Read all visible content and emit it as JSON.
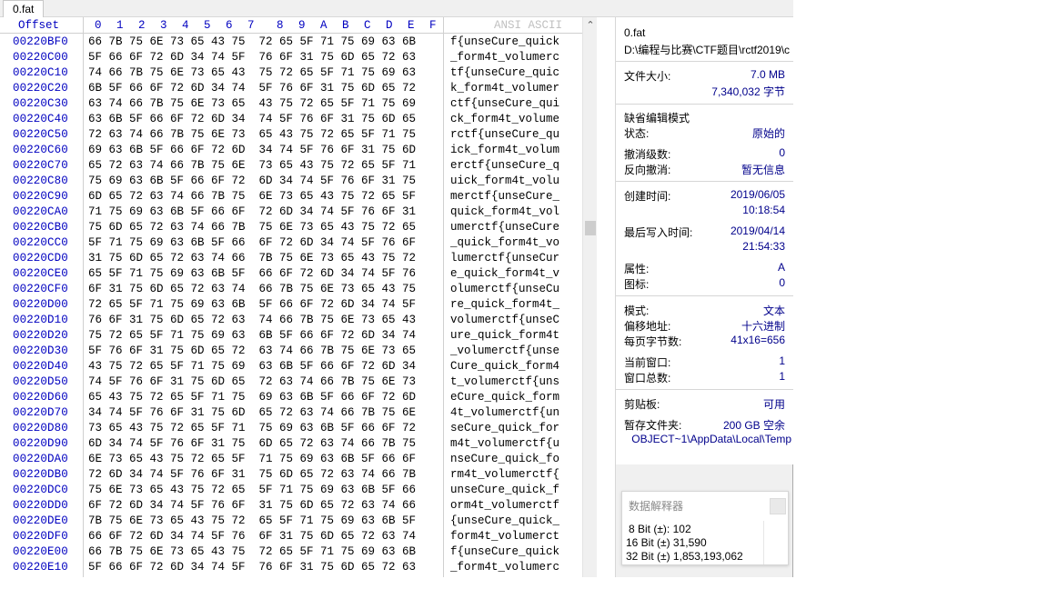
{
  "tab": {
    "label": "0.fat"
  },
  "hex_header": {
    "offset": "Offset",
    "columns": [
      "0",
      "1",
      "2",
      "3",
      "4",
      "5",
      "6",
      "7",
      "8",
      "9",
      "A",
      "B",
      "C",
      "D",
      "E",
      "F"
    ],
    "ascii": "ANSI ASCII"
  },
  "rows": [
    {
      "offset": "00220BF0",
      "hex": "66 7B 75 6E 73 65 43 75  72 65 5F 71 75 69 63 6B",
      "ascii": "f{unseCure_quick"
    },
    {
      "offset": "00220C00",
      "hex": "5F 66 6F 72 6D 34 74 5F  76 6F 31 75 6D 65 72 63",
      "ascii": "_form4t_volumerc"
    },
    {
      "offset": "00220C10",
      "hex": "74 66 7B 75 6E 73 65 43  75 72 65 5F 71 75 69 63",
      "ascii": "tf{unseCure_quic"
    },
    {
      "offset": "00220C20",
      "hex": "6B 5F 66 6F 72 6D 34 74  5F 76 6F 31 75 6D 65 72",
      "ascii": "k_form4t_volumer"
    },
    {
      "offset": "00220C30",
      "hex": "63 74 66 7B 75 6E 73 65  43 75 72 65 5F 71 75 69",
      "ascii": "ctf{unseCure_qui"
    },
    {
      "offset": "00220C40",
      "hex": "63 6B 5F 66 6F 72 6D 34  74 5F 76 6F 31 75 6D 65",
      "ascii": "ck_form4t_volume"
    },
    {
      "offset": "00220C50",
      "hex": "72 63 74 66 7B 75 6E 73  65 43 75 72 65 5F 71 75",
      "ascii": "rctf{unseCure_qu"
    },
    {
      "offset": "00220C60",
      "hex": "69 63 6B 5F 66 6F 72 6D  34 74 5F 76 6F 31 75 6D",
      "ascii": "ick_form4t_volum"
    },
    {
      "offset": "00220C70",
      "hex": "65 72 63 74 66 7B 75 6E  73 65 43 75 72 65 5F 71",
      "ascii": "erctf{unseCure_q"
    },
    {
      "offset": "00220C80",
      "hex": "75 69 63 6B 5F 66 6F 72  6D 34 74 5F 76 6F 31 75",
      "ascii": "uick_form4t_volu"
    },
    {
      "offset": "00220C90",
      "hex": "6D 65 72 63 74 66 7B 75  6E 73 65 43 75 72 65 5F",
      "ascii": "merctf{unseCure_"
    },
    {
      "offset": "00220CA0",
      "hex": "71 75 69 63 6B 5F 66 6F  72 6D 34 74 5F 76 6F 31",
      "ascii": "quick_form4t_vol"
    },
    {
      "offset": "00220CB0",
      "hex": "75 6D 65 72 63 74 66 7B  75 6E 73 65 43 75 72 65",
      "ascii": "umerctf{unseCure"
    },
    {
      "offset": "00220CC0",
      "hex": "5F 71 75 69 63 6B 5F 66  6F 72 6D 34 74 5F 76 6F",
      "ascii": "_quick_form4t_vo"
    },
    {
      "offset": "00220CD0",
      "hex": "31 75 6D 65 72 63 74 66  7B 75 6E 73 65 43 75 72",
      "ascii": "lumerctf{unseCur"
    },
    {
      "offset": "00220CE0",
      "hex": "65 5F 71 75 69 63 6B 5F  66 6F 72 6D 34 74 5F 76",
      "ascii": "e_quick_form4t_v"
    },
    {
      "offset": "00220CF0",
      "hex": "6F 31 75 6D 65 72 63 74  66 7B 75 6E 73 65 43 75",
      "ascii": "olumerctf{unseCu"
    },
    {
      "offset": "00220D00",
      "hex": "72 65 5F 71 75 69 63 6B  5F 66 6F 72 6D 34 74 5F",
      "ascii": "re_quick_form4t_"
    },
    {
      "offset": "00220D10",
      "hex": "76 6F 31 75 6D 65 72 63  74 66 7B 75 6E 73 65 43",
      "ascii": "volumerctf{unseC"
    },
    {
      "offset": "00220D20",
      "hex": "75 72 65 5F 71 75 69 63  6B 5F 66 6F 72 6D 34 74",
      "ascii": "ure_quick_form4t"
    },
    {
      "offset": "00220D30",
      "hex": "5F 76 6F 31 75 6D 65 72  63 74 66 7B 75 6E 73 65",
      "ascii": "_volumerctf{unse"
    },
    {
      "offset": "00220D40",
      "hex": "43 75 72 65 5F 71 75 69  63 6B 5F 66 6F 72 6D 34",
      "ascii": "Cure_quick_form4"
    },
    {
      "offset": "00220D50",
      "hex": "74 5F 76 6F 31 75 6D 65  72 63 74 66 7B 75 6E 73",
      "ascii": "t_volumerctf{uns"
    },
    {
      "offset": "00220D60",
      "hex": "65 43 75 72 65 5F 71 75  69 63 6B 5F 66 6F 72 6D",
      "ascii": "eCure_quick_form"
    },
    {
      "offset": "00220D70",
      "hex": "34 74 5F 76 6F 31 75 6D  65 72 63 74 66 7B 75 6E",
      "ascii": "4t_volumerctf{un"
    },
    {
      "offset": "00220D80",
      "hex": "73 65 43 75 72 65 5F 71  75 69 63 6B 5F 66 6F 72",
      "ascii": "seCure_quick_for"
    },
    {
      "offset": "00220D90",
      "hex": "6D 34 74 5F 76 6F 31 75  6D 65 72 63 74 66 7B 75",
      "ascii": "m4t_volumerctf{u"
    },
    {
      "offset": "00220DA0",
      "hex": "6E 73 65 43 75 72 65 5F  71 75 69 63 6B 5F 66 6F",
      "ascii": "nseCure_quick_fo"
    },
    {
      "offset": "00220DB0",
      "hex": "72 6D 34 74 5F 76 6F 31  75 6D 65 72 63 74 66 7B",
      "ascii": "rm4t_volumerctf{"
    },
    {
      "offset": "00220DC0",
      "hex": "75 6E 73 65 43 75 72 65  5F 71 75 69 63 6B 5F 66",
      "ascii": "unseCure_quick_f"
    },
    {
      "offset": "00220DD0",
      "hex": "6F 72 6D 34 74 5F 76 6F  31 75 6D 65 72 63 74 66",
      "ascii": "orm4t_volumerctf"
    },
    {
      "offset": "00220DE0",
      "hex": "7B 75 6E 73 65 43 75 72  65 5F 71 75 69 63 6B 5F",
      "ascii": "{unseCure_quick_"
    },
    {
      "offset": "00220DF0",
      "hex": "66 6F 72 6D 34 74 5F 76  6F 31 75 6D 65 72 63 74",
      "ascii": "form4t_volumerct"
    },
    {
      "offset": "00220E00",
      "hex": "66 7B 75 6E 73 65 43 75  72 65 5F 71 75 69 63 6B",
      "ascii": "f{unseCure_quick"
    },
    {
      "offset": "00220E10",
      "hex": "5F 66 6F 72 6D 34 74 5F  76 6F 31 75 6D 65 72 63",
      "ascii": "_form4t_volumerc"
    }
  ],
  "info": {
    "file_name": "0.fat",
    "file_path": "D:\\编程与比赛\\CTF题目\\rctf2019\\c",
    "size_label": "文件大小:",
    "size_mb": "7.0 MB",
    "size_bytes": "7,340,032 字节",
    "edit_mode_heading": "缺省编辑模式",
    "state_label": "状态:",
    "state_value": "原始的",
    "undo_label": "撤消级数:",
    "undo_value": "0",
    "redo_label": "反向撤消:",
    "redo_value": "暂无信息",
    "created_label": "创建时间:",
    "created_date": "2019/06/05",
    "created_time": "10:18:54",
    "written_label": "最后写入时间:",
    "written_date": "2019/04/14",
    "written_time": "21:54:33",
    "attr_label": "属性:",
    "attr_value": "A",
    "icon_label": "图标:",
    "icon_value": "0",
    "mode_label": "模式:",
    "mode_value": "文本",
    "offset_label": "偏移地址:",
    "offset_value": "十六进制",
    "bpp_label": "每页字节数:",
    "bpp_value": "41x16=656",
    "curwin_label": "当前窗口:",
    "curwin_value": "1",
    "totalwin_label": "窗口总数:",
    "totalwin_value": "1",
    "clip_label": "剪贴板:",
    "clip_value": "可用",
    "temp_label": "暂存文件夹:",
    "temp_value": "200 GB 空余",
    "temp_path": "OBJECT~1\\AppData\\Local\\Temp"
  },
  "interpreter": {
    "title": "数据解释器",
    "bit8": "8 Bit (±): 102",
    "bit16": "16 Bit (±) 31,590",
    "bit32": "32 Bit (±) 1,853,193,062"
  }
}
